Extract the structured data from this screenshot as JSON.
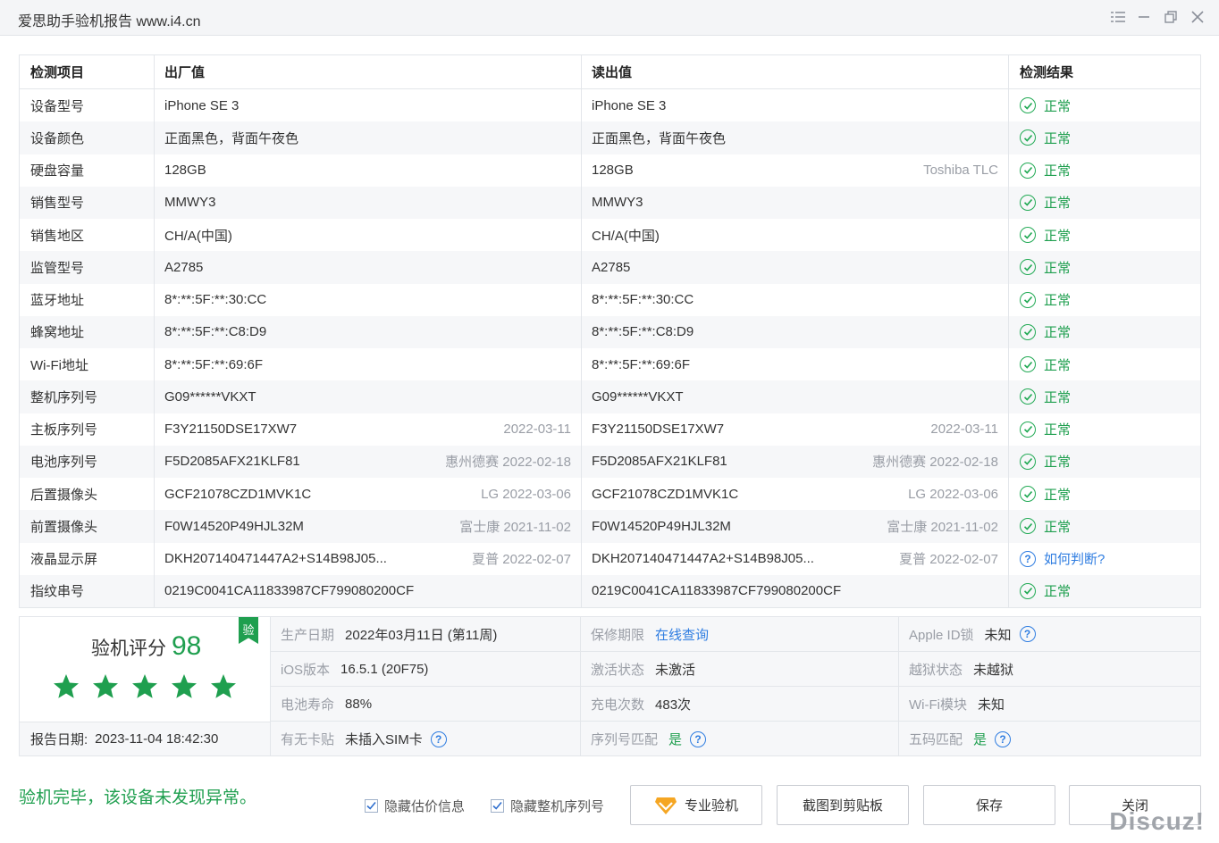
{
  "window": {
    "title": "爱思助手验机报告 www.i4.cn"
  },
  "table": {
    "headers": [
      "检测项目",
      "出厂值",
      "读出值",
      "检测结果"
    ],
    "rows": [
      {
        "item": "设备型号",
        "factory": "iPhone SE 3",
        "factory_note": "",
        "read": "iPhone SE 3",
        "read_note": "",
        "result": "正常",
        "status": "ok"
      },
      {
        "item": "设备颜色",
        "factory": "正面黑色，背面午夜色",
        "factory_note": "",
        "read": "正面黑色，背面午夜色",
        "read_note": "",
        "result": "正常",
        "status": "ok"
      },
      {
        "item": "硬盘容量",
        "factory": "128GB",
        "factory_note": "",
        "read": "128GB",
        "read_note": "Toshiba TLC",
        "result": "正常",
        "status": "ok"
      },
      {
        "item": "销售型号",
        "factory": "MMWY3",
        "factory_note": "",
        "read": "MMWY3",
        "read_note": "",
        "result": "正常",
        "status": "ok"
      },
      {
        "item": "销售地区",
        "factory": "CH/A(中国)",
        "factory_note": "",
        "read": "CH/A(中国)",
        "read_note": "",
        "result": "正常",
        "status": "ok"
      },
      {
        "item": "监管型号",
        "factory": "A2785",
        "factory_note": "",
        "read": "A2785",
        "read_note": "",
        "result": "正常",
        "status": "ok"
      },
      {
        "item": "蓝牙地址",
        "factory": "8*:**:5F:**:30:CC",
        "factory_note": "",
        "read": "8*:**:5F:**:30:CC",
        "read_note": "",
        "result": "正常",
        "status": "ok"
      },
      {
        "item": "蜂窝地址",
        "factory": "8*:**:5F:**:C8:D9",
        "factory_note": "",
        "read": "8*:**:5F:**:C8:D9",
        "read_note": "",
        "result": "正常",
        "status": "ok"
      },
      {
        "item": "Wi-Fi地址",
        "factory": "8*:**:5F:**:69:6F",
        "factory_note": "",
        "read": "8*:**:5F:**:69:6F",
        "read_note": "",
        "result": "正常",
        "status": "ok"
      },
      {
        "item": "整机序列号",
        "factory": "G09******VKXT",
        "factory_note": "",
        "read": "G09******VKXT",
        "read_note": "",
        "result": "正常",
        "status": "ok"
      },
      {
        "item": "主板序列号",
        "factory": "F3Y21150DSE17XW7",
        "factory_note": "2022-03-11",
        "read": "F3Y21150DSE17XW7",
        "read_note": "2022-03-11",
        "result": "正常",
        "status": "ok"
      },
      {
        "item": "电池序列号",
        "factory": "F5D2085AFX21KLF81",
        "factory_note": "惠州德赛 2022-02-18",
        "read": "F5D2085AFX21KLF81",
        "read_note": "惠州德赛 2022-02-18",
        "result": "正常",
        "status": "ok"
      },
      {
        "item": "后置摄像头",
        "factory": "GCF21078CZD1MVK1C",
        "factory_note": "LG 2022-03-06",
        "read": "GCF21078CZD1MVK1C",
        "read_note": "LG 2022-03-06",
        "result": "正常",
        "status": "ok"
      },
      {
        "item": "前置摄像头",
        "factory": "F0W14520P49HJL32M",
        "factory_note": "富士康 2021-11-02",
        "read": "F0W14520P49HJL32M",
        "read_note": "富士康 2021-11-02",
        "result": "正常",
        "status": "ok"
      },
      {
        "item": "液晶显示屏",
        "factory": "DKH207140471447A2+S14B98J05...",
        "factory_note": "夏普 2022-02-07",
        "read": "DKH207140471447A2+S14B98J05...",
        "read_note": "夏普 2022-02-07",
        "result": "如何判断?",
        "status": "question"
      },
      {
        "item": "指纹串号",
        "factory": "0219C0041CA11833987CF799080200CF",
        "factory_note": "",
        "read": "0219C0041CA11833987CF799080200CF",
        "read_note": "",
        "result": "正常",
        "status": "ok"
      }
    ]
  },
  "score": {
    "label": "验机评分",
    "value": "98",
    "stars": 5,
    "badge": "验",
    "report_date_label": "报告日期:",
    "report_date": "2023-11-04 18:42:30"
  },
  "info": {
    "production_date_label": "生产日期",
    "production_date": "2022年03月11日 (第11周)",
    "warranty_label": "保修期限",
    "warranty_link": "在线查询",
    "apple_id_label": "Apple ID锁",
    "apple_id": "未知",
    "ios_label": "iOS版本",
    "ios": "16.5.1 (20F75)",
    "activation_label": "激活状态",
    "activation": "未激活",
    "jailbreak_label": "越狱状态",
    "jailbreak": "未越狱",
    "battery_label": "电池寿命",
    "battery": "88%",
    "charge_label": "充电次数",
    "charge": "483次",
    "wifi_label": "Wi-Fi模块",
    "wifi": "未知",
    "sim_label": "有无卡贴",
    "sim": "未插入SIM卡",
    "serial_match_label": "序列号匹配",
    "serial_match": "是",
    "five_code_label": "五码匹配",
    "five_code": "是"
  },
  "footer": {
    "status_message": "验机完毕，该设备未发现异常。",
    "hide_price_label": "隐藏估价信息",
    "hide_serial_label": "隐藏整机序列号",
    "pro_button": "专业验机",
    "screenshot_button": "截图到剪贴板",
    "save_button": "保存",
    "close_button": "关闭"
  },
  "watermark": "Discuz!",
  "colors": {
    "ok_green": "#1f9f4f",
    "link_blue": "#2f7de1",
    "star_green": "#1f9f4f"
  }
}
